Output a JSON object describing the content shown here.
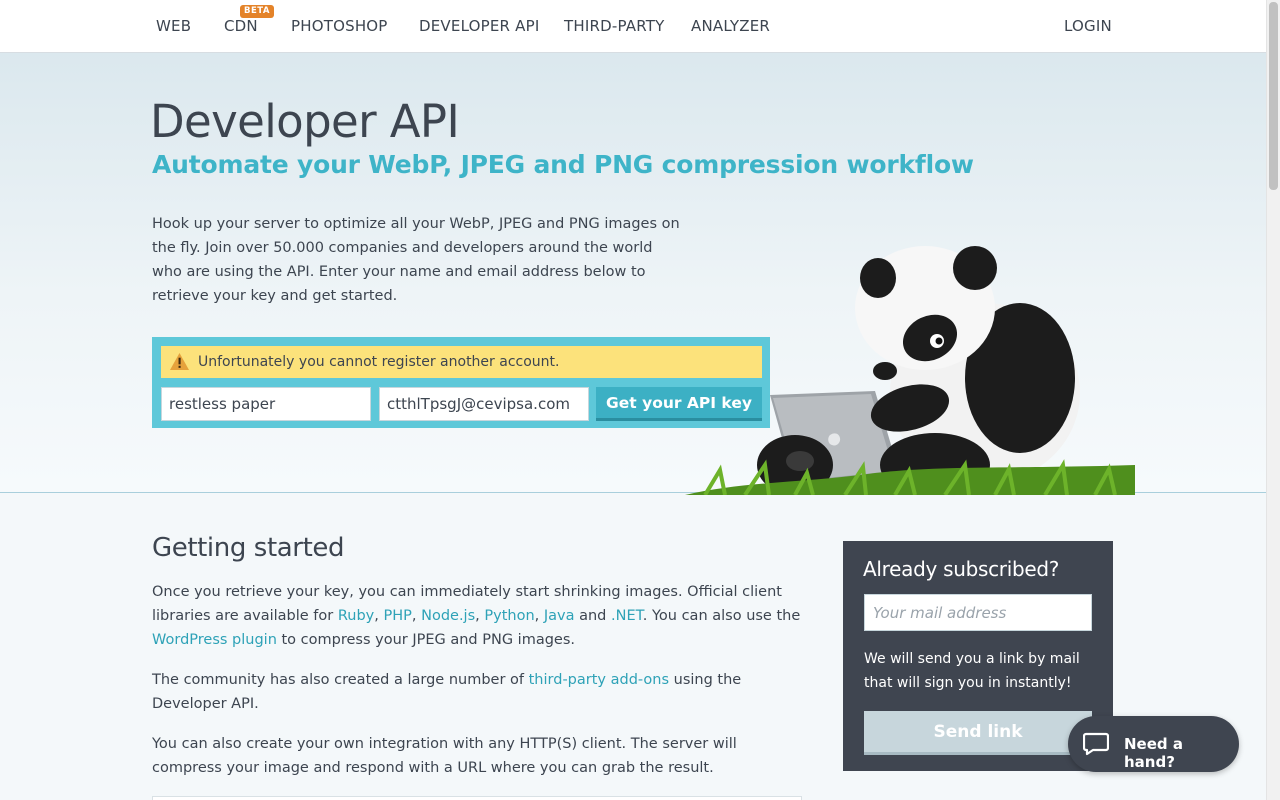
{
  "nav": {
    "items": [
      {
        "label": "WEB"
      },
      {
        "label": "CDN"
      },
      {
        "label": "PHOTOSHOP"
      },
      {
        "label": "DEVELOPER API"
      },
      {
        "label": "THIRD-PARTY"
      },
      {
        "label": "ANALYZER"
      }
    ],
    "cdn_badge": "BETA",
    "login": "LOGIN"
  },
  "hero": {
    "title": "Developer API",
    "subtitle": "Automate your WebP, JPEG and PNG compression workflow",
    "description": "Hook up your server to optimize all your WebP, JPEG and PNG images on the fly. Join over 50.000 companies and developers around the world who are using the API. Enter your name and email address below to retrieve your key and get started.",
    "warning": "Unfortunately you cannot register another account.",
    "name_value": "restless paper",
    "email_value": "ctthlTpsgJ@cevipsa.com",
    "submit_label": "Get your API key"
  },
  "content": {
    "title": "Getting started",
    "p1": {
      "t1": "Once you retrieve your key, you can immediately start shrinking images. Official client libraries are available for ",
      "ruby": "Ruby",
      "comma1": ", ",
      "php": "PHP",
      "comma2": ", ",
      "node": "Node.js",
      "comma3": ", ",
      "python": "Python",
      "comma4": ", ",
      "java": "Java",
      "and": " and ",
      "dotnet": ".NET",
      "t2": ". You can also use the ",
      "wordpress": "WordPress plugin",
      "t3": " to compress your JPEG and PNG images."
    },
    "p2": {
      "t1": "The community has also created a large number of ",
      "link": "third-party add-ons",
      "t2": " using the Developer API."
    },
    "p3": "You can also create your own integration with any HTTP(S) client. The server will compress your image and respond with a URL where you can grab the result."
  },
  "sidebar": {
    "title": "Already subscribed?",
    "mail_placeholder": "Your mail address",
    "text": "We will send you a link by mail that will sign you in instantly!",
    "button": "Send link"
  },
  "help": {
    "label": "Need a hand?"
  },
  "colors": {
    "accent": "#3eb4c8",
    "warning_bg": "#fce27b",
    "register_bg": "#5ec8d9",
    "sidebar_bg": "#3f4550",
    "beta_badge": "#e48329"
  },
  "icons": [
    "warning-icon",
    "panda-illustration",
    "chat-icon"
  ]
}
